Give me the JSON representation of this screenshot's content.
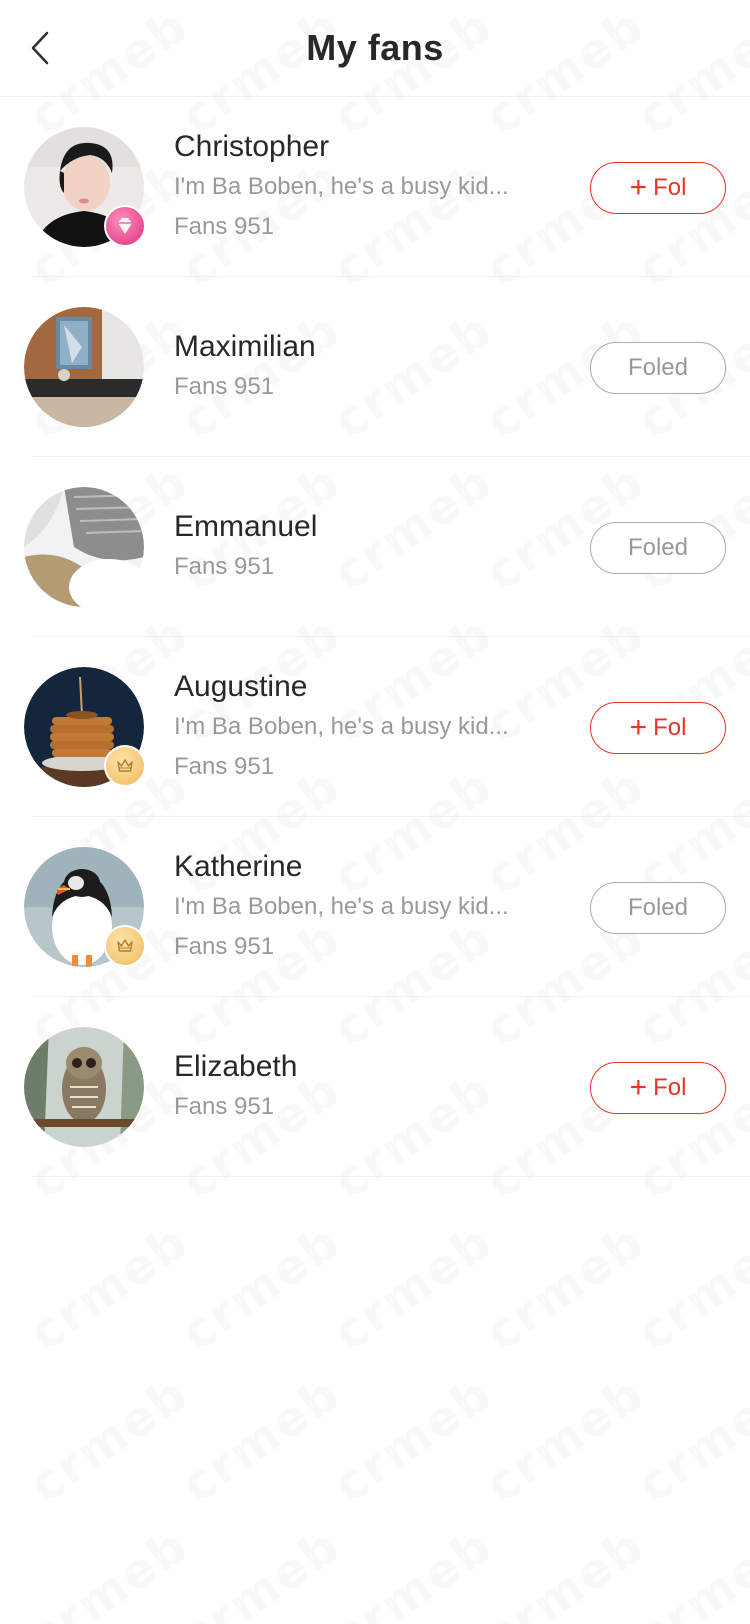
{
  "header": {
    "title": "My fans",
    "back_icon": "chevron-left-icon"
  },
  "colors": {
    "accent": "#e93323",
    "text_primary": "#282828",
    "text_secondary": "#999999",
    "divider": "#f0f0f0",
    "followed_border": "#aaaaaa"
  },
  "watermark_text": "crmeb",
  "fans": [
    {
      "name": "Christopher",
      "bio": "I'm Ba Boben, he's a busy kid...",
      "fans_label": "Fans 951",
      "badge": "diamond",
      "avatar": "portrait-photo",
      "follow_state": "unfollowed",
      "button_label": "Fol"
    },
    {
      "name": "Maximilian",
      "bio": "",
      "fans_label": "Fans 951",
      "badge": "",
      "avatar": "interior-photo",
      "follow_state": "followed",
      "button_label": "Foled"
    },
    {
      "name": "Emmanuel",
      "bio": "",
      "fans_label": "Fans 951",
      "badge": "",
      "avatar": "fabric-photo",
      "follow_state": "followed",
      "button_label": "Foled"
    },
    {
      "name": "Augustine",
      "bio": "I'm Ba Boben, he's a busy kid...",
      "fans_label": "Fans 951",
      "badge": "crown",
      "avatar": "pancakes-photo",
      "follow_state": "unfollowed",
      "button_label": "Fol"
    },
    {
      "name": "Katherine",
      "bio": "I'm Ba Boben, he's a busy kid...",
      "fans_label": "Fans 951",
      "badge": "crown",
      "avatar": "puffin-photo",
      "follow_state": "followed",
      "button_label": "Foled"
    },
    {
      "name": "Elizabeth",
      "bio": "",
      "fans_label": "Fans 951",
      "badge": "",
      "avatar": "owl-photo",
      "follow_state": "unfollowed",
      "button_label": "Fol"
    }
  ]
}
